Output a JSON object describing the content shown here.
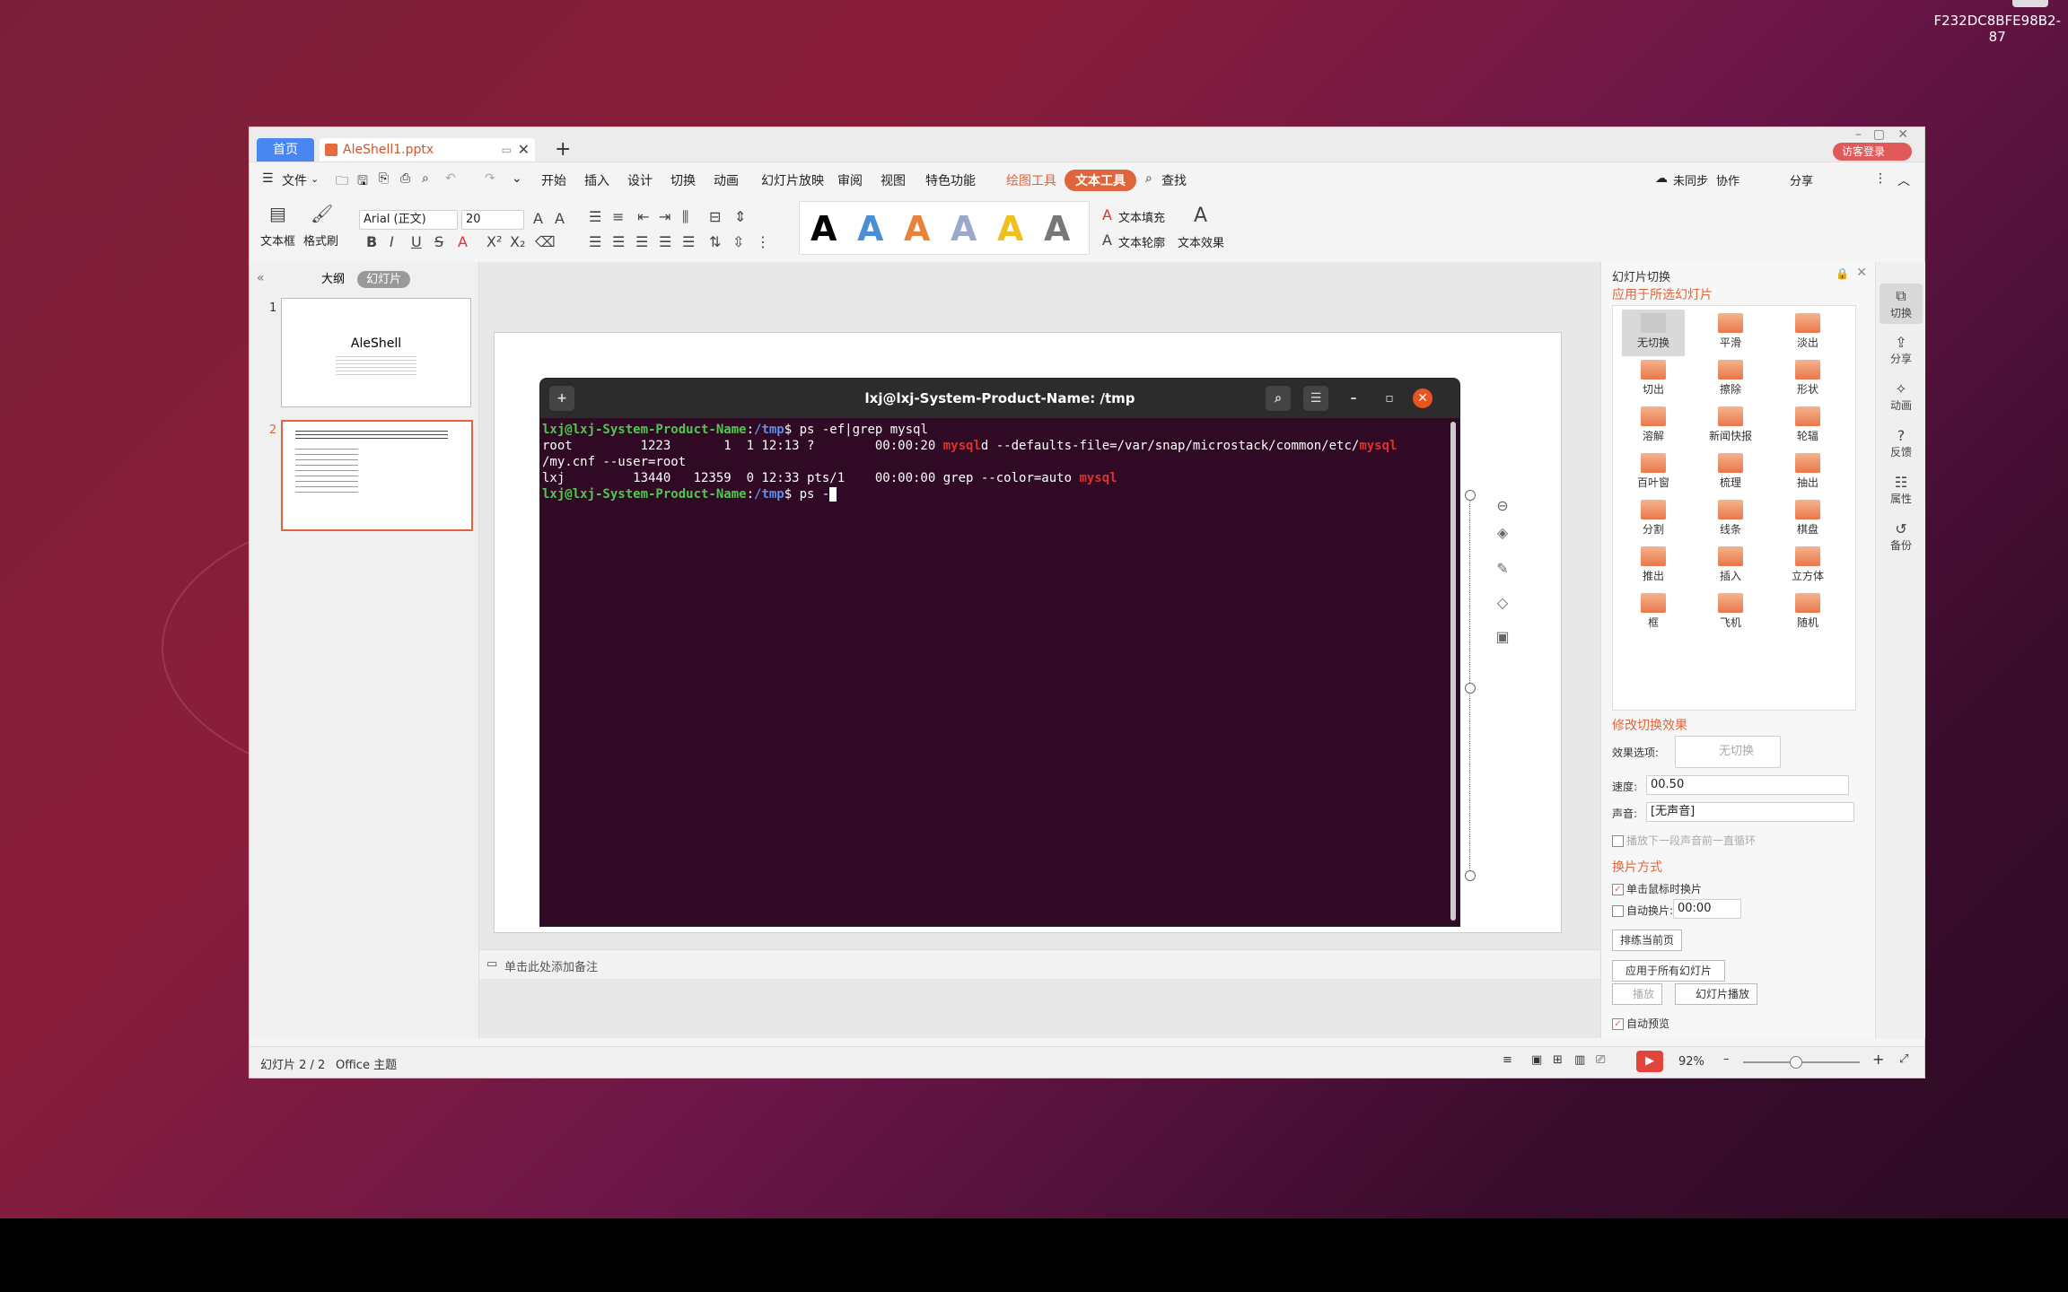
{
  "desktop": {
    "corner_id_line1": "F232DC8BFE98B2-",
    "corner_id_line2": "87"
  },
  "tabs": {
    "home": "首页",
    "doc": "AleShell1.pptx",
    "visitor": "访客登录"
  },
  "menu": {
    "file": "文件",
    "items": [
      "开始",
      "插入",
      "设计",
      "切换",
      "动画",
      "幻灯片放映",
      "审阅",
      "视图",
      "特色功能"
    ],
    "draw_tools": "绘图工具",
    "text_tools": "文本工具",
    "search": "查找",
    "unsync": "未同步",
    "collab": "协作",
    "share": "分享"
  },
  "ribbon": {
    "textbox": "文本框",
    "format_painter": "格式刷",
    "font_name": "Arial (正文)",
    "font_size": "20",
    "text_fill": "文本填充",
    "text_outline": "文本轮廓",
    "text_effect": "文本效果",
    "styles": [
      {
        "char": "A",
        "color": "#000000"
      },
      {
        "char": "A",
        "color": "#4a8fd6"
      },
      {
        "char": "A",
        "color": "#e8823a"
      },
      {
        "char": "A",
        "color": "#9aa9c9"
      },
      {
        "char": "A",
        "color": "#f0c020"
      },
      {
        "char": "A",
        "color": "#777777"
      }
    ]
  },
  "left": {
    "outline": "大纲",
    "slides": "幻灯片",
    "slide1_num": "1",
    "slide1_title": "AleShell",
    "slide2_num": "2"
  },
  "terminal": {
    "title": "lxj@lxj-System-Product-Name: /tmp",
    "prompt_user": "lxj@lxj-System-Product-Name",
    "prompt_path": "/tmp",
    "cmd1": "ps -ef|grep mysql",
    "line2a": "root         1223       1  1 12:13 ?        00:00:20 ",
    "line2b": "mysql",
    "line2c": "d --defaults-file=/var/snap/microstack/common/etc/",
    "line2d": "mysql",
    "line3": "/my.cnf --user=root",
    "line4a": "lxj         13440   12359  0 12:33 pts/1    00:00:00 grep --color=auto ",
    "line4b": "mysql",
    "cmd2": "ps -"
  },
  "notes": {
    "placeholder": "单击此处添加备注"
  },
  "panel": {
    "title": "幻灯片切换",
    "apply_selected": "应用于所选幻灯片",
    "transitions": [
      "无切换",
      "平滑",
      "淡出",
      "切出",
      "擦除",
      "形状",
      "溶解",
      "新闻快报",
      "轮辐",
      "百叶窗",
      "梳理",
      "抽出",
      "分割",
      "线条",
      "棋盘",
      "推出",
      "插入",
      "立方体",
      "框",
      "飞机",
      "随机"
    ],
    "modify": "修改切换效果",
    "effect_label": "效果选项:",
    "effect_value": "无切换",
    "speed_label": "速度:",
    "speed_value": "00.50",
    "sound_label": "声音:",
    "sound_value": "[无声音]",
    "loop": "播放下一段声音前一直循环",
    "method": "换片方式",
    "on_click": "单击鼠标时换片",
    "auto": "自动换片:",
    "auto_value": "00:00",
    "rehearse": "排练当前页",
    "apply_all": "应用于所有幻灯片",
    "play": "播放",
    "slideshow": "幻灯片播放",
    "autopreview": "自动预览"
  },
  "rightbar": [
    "切换",
    "分享",
    "动画",
    "反馈",
    "属性",
    "备份"
  ],
  "status": {
    "slide": "幻灯片 2 / 2",
    "theme": "Office 主题",
    "zoom": "92%"
  }
}
